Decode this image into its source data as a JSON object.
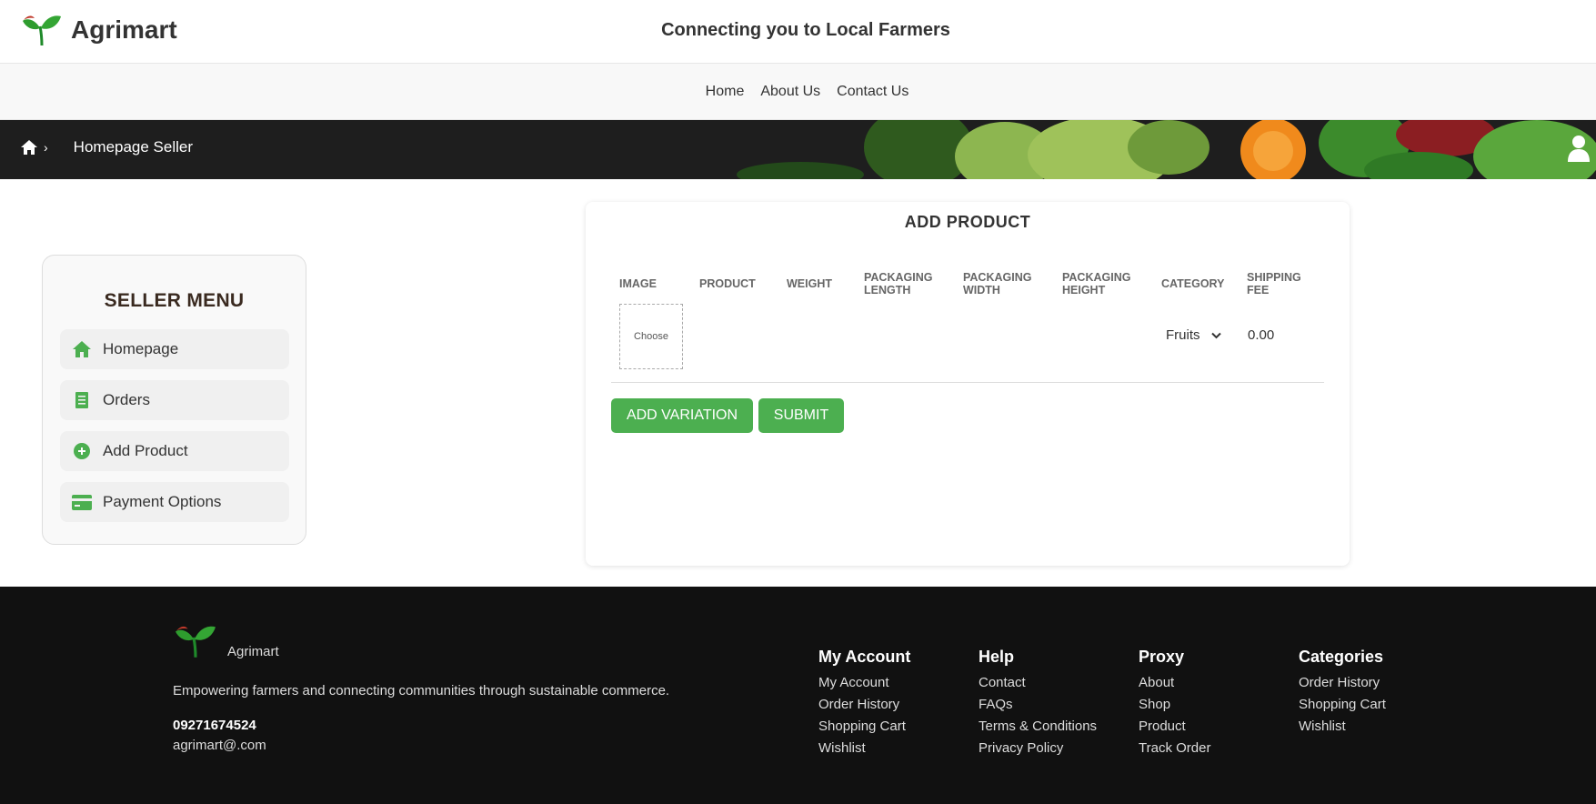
{
  "header": {
    "brand": "Agrimart",
    "tagline": "Connecting you to Local Farmers"
  },
  "nav": {
    "items": [
      "Home",
      "About Us",
      "Contact Us"
    ]
  },
  "breadcrumb": {
    "separator": "›",
    "current": "Homepage Seller"
  },
  "seller_menu": {
    "title": "SELLER MENU",
    "items": [
      {
        "label": "Homepage",
        "icon": "home-icon"
      },
      {
        "label": "Orders",
        "icon": "receipt-icon"
      },
      {
        "label": "Add Product",
        "icon": "plus-circle-icon"
      },
      {
        "label": "Payment Options",
        "icon": "credit-card-icon"
      }
    ]
  },
  "add_product": {
    "title": "ADD PRODUCT",
    "columns": [
      [
        "IMAGE"
      ],
      [
        "PRODUCT"
      ],
      [
        "WEIGHT"
      ],
      [
        "PACKAGING",
        "LENGTH"
      ],
      [
        "PACKAGING",
        "WIDTH"
      ],
      [
        "PACKAGING",
        "HEIGHT"
      ],
      [
        "CATEGORY"
      ],
      [
        "SHIPPING",
        "FEE"
      ]
    ],
    "row": {
      "image_button": "Choose",
      "category": "Fruits",
      "shipping_fee": "0.00"
    },
    "buttons": {
      "add_variation": "ADD VARIATION",
      "submit": "SUBMIT"
    }
  },
  "footer": {
    "brand": "Agrimart",
    "description": "Empowering farmers and connecting communities through sustainable commerce.",
    "phone": "09271674524",
    "email": "agrimart@.com",
    "columns": [
      {
        "title": "My Account",
        "links": [
          "My Account",
          "Order History",
          "Shopping Cart",
          "Wishlist"
        ]
      },
      {
        "title": "Help",
        "links": [
          "Contact",
          "FAQs",
          "Terms & Conditions",
          "Privacy Policy"
        ]
      },
      {
        "title": "Proxy",
        "links": [
          "About",
          "Shop",
          "Product",
          "Track Order"
        ]
      },
      {
        "title": "Categories",
        "links": [
          "Order History",
          "Shopping Cart",
          "Wishlist"
        ]
      }
    ]
  },
  "colors": {
    "accent_green": "#4caf50",
    "footer_bg": "#111111",
    "menu_title": "#3a2a20"
  }
}
